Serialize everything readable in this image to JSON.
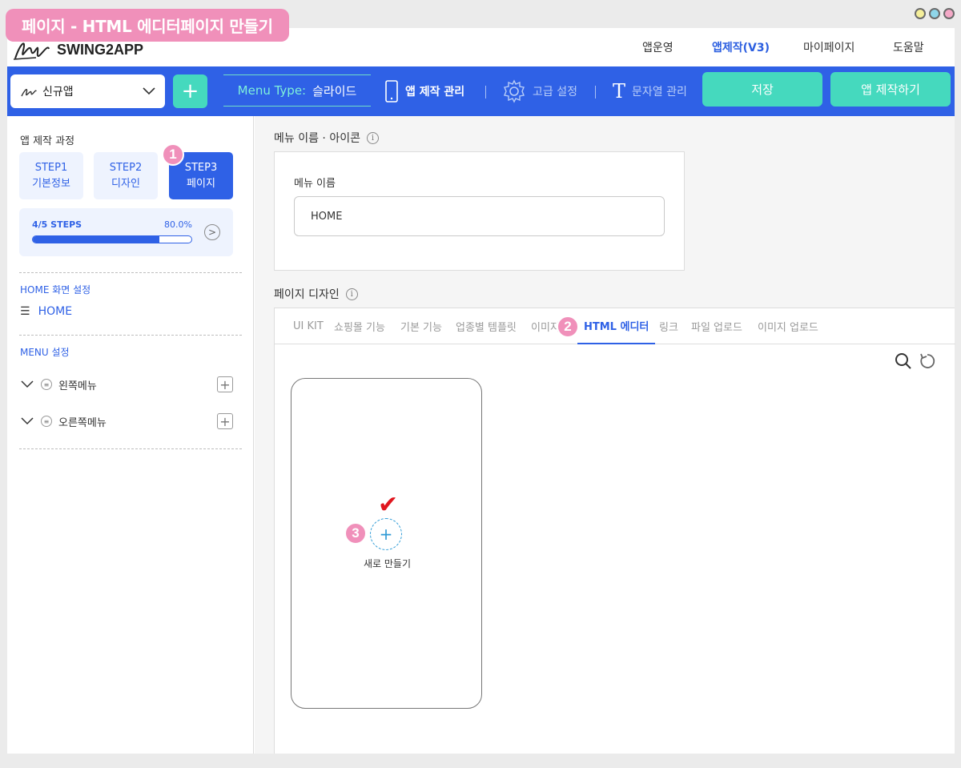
{
  "page_title": "페이지 - HTML 에디터페이지 만들기",
  "brand": {
    "name": "SWING2APP"
  },
  "topnav": [
    "앱운영",
    "앱제작(V3)",
    "마이페이지",
    "도움말"
  ],
  "toolbar": {
    "app_name": "신규앱",
    "add_label": "+",
    "menu_type_label": "Menu Type:",
    "menu_type_value": "슬라이드",
    "manage_label": "앱 제작 관리",
    "advanced_label": "고급 설정",
    "strings_label": "문자열 관리",
    "save_label": "저장",
    "build_label": "앱 제작하기"
  },
  "sidebar": {
    "process_title": "앱 제작 과정",
    "steps": [
      {
        "line1": "STEP1",
        "line2": "기본정보"
      },
      {
        "line1": "STEP2",
        "line2": "디자인"
      },
      {
        "line1": "STEP3",
        "line2": "페이지"
      }
    ],
    "progress": {
      "label": "4/5 STEPS",
      "percent_text": "80.0%",
      "percent": 80
    },
    "home_section": "HOME 화면 설정",
    "home_item": "HOME",
    "menu_section": "MENU 설정",
    "menus": [
      "왼쪽메뉴",
      "오른쪽메뉴"
    ]
  },
  "main": {
    "name_section": "메뉴 이름 · 아이콘",
    "name_label": "메뉴 이름",
    "name_value": "HOME",
    "design_section": "페이지 디자인",
    "tabs": [
      "UI KIT",
      "쇼핑몰 기능",
      "기본 기능",
      "업종별 템플릿",
      "이미지",
      "HTML 에디터",
      "링크",
      "파일 업로드",
      "이미지 업로드"
    ],
    "active_tab": "HTML 에디터",
    "new_label": "새로 만들기"
  },
  "badges": [
    "1",
    "2",
    "3"
  ],
  "colors": {
    "primary": "#2f61e6",
    "accent": "#45d9be",
    "badge": "#f090ba",
    "check": "#e0161e"
  }
}
